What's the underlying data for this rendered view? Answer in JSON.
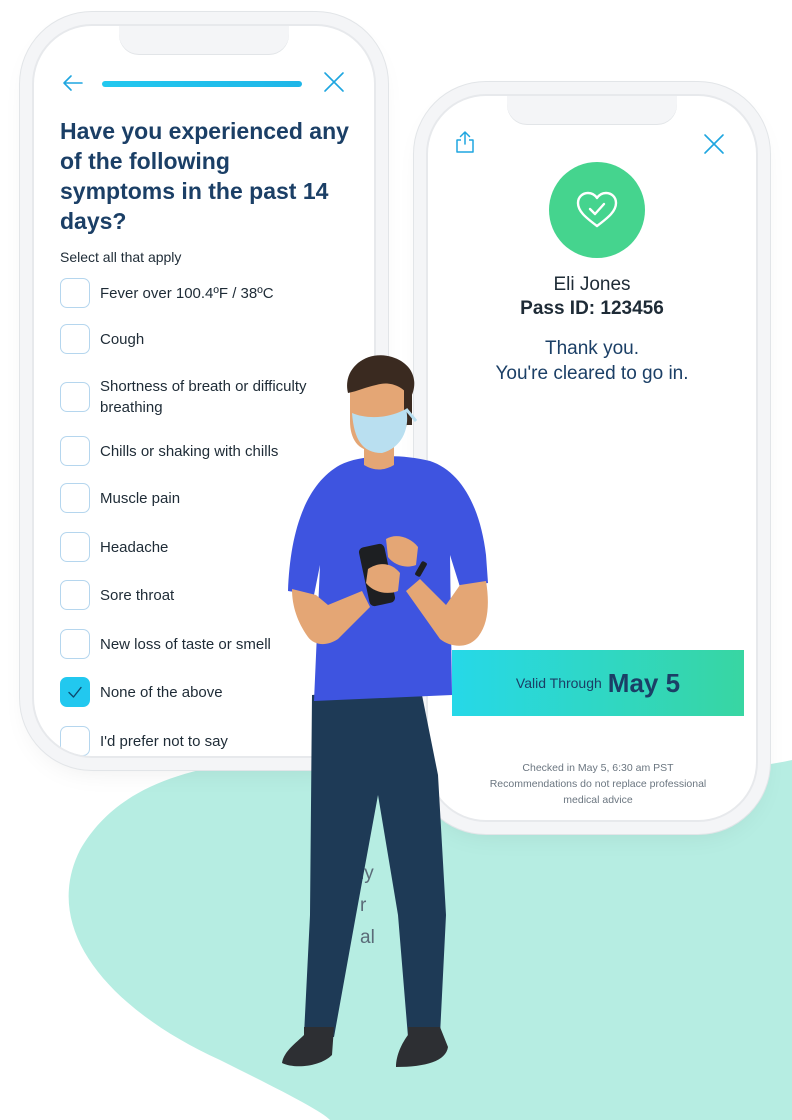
{
  "colors": {
    "blob": "#b6ede2",
    "accent": "#22c8ef",
    "success": "#45d48e",
    "heading": "#1b3f66"
  },
  "background_text": [
    "ly",
    "r",
    "al"
  ],
  "survey": {
    "back_icon": "arrow-left-icon",
    "close_icon": "close-icon",
    "progress": 1.0,
    "question": "Have you experienced any of the following symptoms in the past 14 days?",
    "hint": "Select all that apply",
    "options": [
      {
        "label": "Fever over 100.4ºF / 38ºC",
        "checked": false
      },
      {
        "label": "Cough",
        "checked": false
      },
      {
        "label": "Shortness of breath or difficulty breathing",
        "checked": false
      },
      {
        "label": "Chills or shaking with chills",
        "checked": false
      },
      {
        "label": "Muscle pain",
        "checked": false
      },
      {
        "label": "Headache",
        "checked": false
      },
      {
        "label": "Sore throat",
        "checked": false
      },
      {
        "label": "New loss of taste or smell",
        "checked": false
      },
      {
        "label": "None of the above",
        "checked": true
      },
      {
        "label": "I'd prefer not to say",
        "checked": false
      }
    ]
  },
  "pass": {
    "share_icon": "share-icon",
    "close_icon": "close-icon",
    "badge_icon": "heart-check-icon",
    "name": "Eli Jones",
    "pass_id": "Pass ID: 123456",
    "message_line1": "Thank you.",
    "message_line2": "You're cleared to go in.",
    "valid_label": "Valid Through",
    "valid_date": "May 5",
    "checked_in": "Checked in May 5, 6:30 am PST",
    "disclaimer_line1": "Recommendations do not replace professional",
    "disclaimer_line2": "medical advice"
  }
}
